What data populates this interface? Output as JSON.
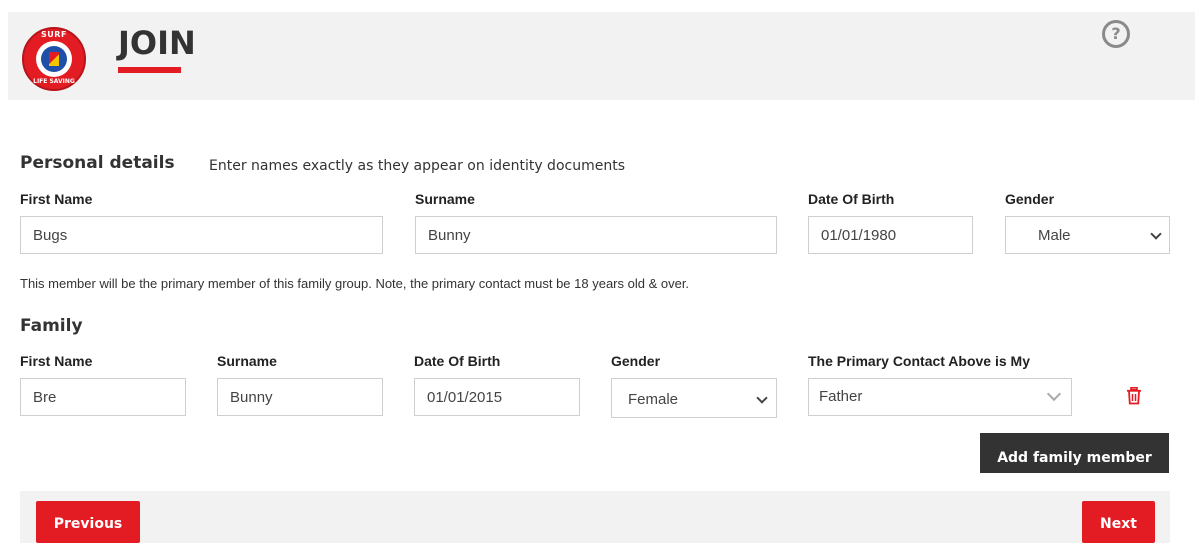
{
  "header": {
    "title": "JOIN",
    "logo_top_text": "SURF",
    "logo_bottom_text": "LIFE SAVING",
    "help_icon": "question-circle-icon"
  },
  "personal": {
    "heading": "Personal details",
    "subheading": "Enter names exactly as they appear on identity documents",
    "first_name_label": "First Name",
    "first_name_value": "Bugs",
    "surname_label": "Surname",
    "surname_value": "Bunny",
    "dob_label": "Date Of Birth",
    "dob_value": "01/01/1980",
    "gender_label": "Gender",
    "gender_value": "Male",
    "note": "This member will be the primary member of this family group. Note, the primary contact must be 18 years old & over."
  },
  "family": {
    "heading": "Family",
    "first_name_label": "First Name",
    "surname_label": "Surname",
    "dob_label": "Date Of Birth",
    "gender_label": "Gender",
    "relation_label": "The Primary Contact Above is My",
    "member": {
      "first_name": "Bre",
      "surname": "Bunny",
      "dob": "01/01/2015",
      "gender": "Female",
      "relation": "Father"
    },
    "delete_icon": "trash-icon",
    "add_button": "Add family member"
  },
  "footer": {
    "previous": "Previous",
    "next": "Next"
  },
  "colors": {
    "accent": "#e31b23",
    "dark_button": "#333333"
  }
}
